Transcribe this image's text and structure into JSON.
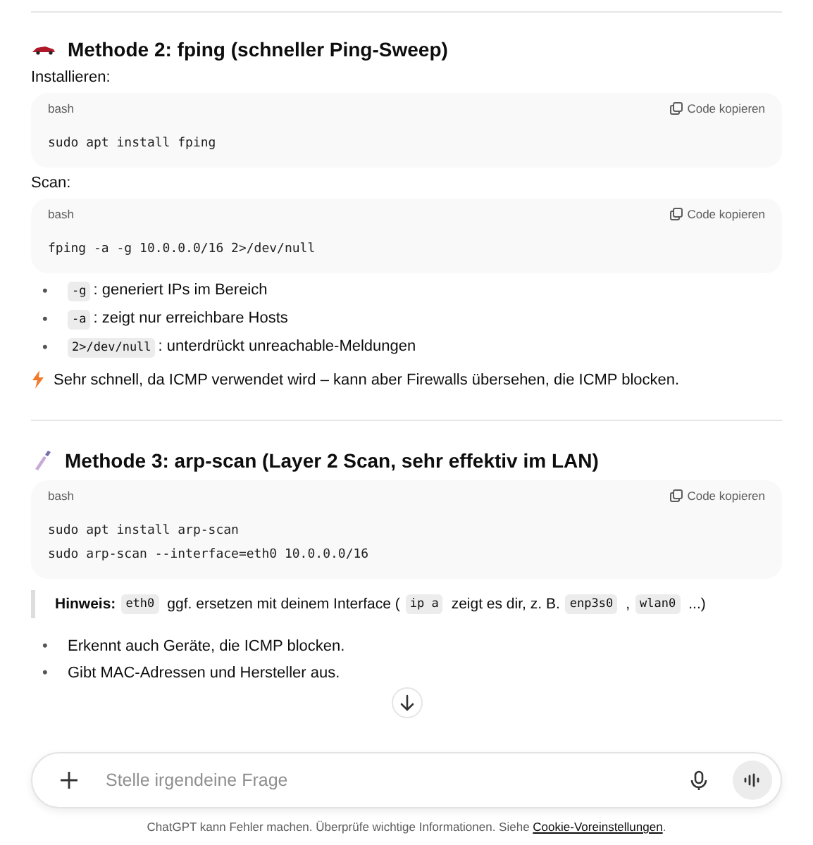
{
  "sections": [
    {
      "title": "Methode 2: fping (schneller Ping-Sweep)",
      "blocks": [
        {
          "kind": "para",
          "text": "Installieren:"
        },
        {
          "kind": "code",
          "language": "bash",
          "copy_label": "Code kopieren",
          "lines": [
            "sudo apt install fping"
          ]
        },
        {
          "kind": "para",
          "text": "Scan:"
        },
        {
          "kind": "code",
          "language": "bash",
          "copy_label": "Code kopieren",
          "lines": [
            "fping -a -g 10.0.0.0/16 2>/dev/null"
          ]
        },
        {
          "kind": "bullets",
          "marker": "•",
          "items": [
            {
              "parts": [
                {
                  "kind": "code",
                  "text": "-g"
                },
                {
                  "kind": "text",
                  "text": ": generiert IPs im Bereich"
                }
              ]
            },
            {
              "parts": [
                {
                  "kind": "code",
                  "text": "-a"
                },
                {
                  "kind": "text",
                  "text": ": zeigt nur erreichbare Hosts"
                }
              ]
            },
            {
              "parts": [
                {
                  "kind": "code",
                  "text": "2>/dev/null"
                },
                {
                  "kind": "text",
                  "text": ": unterdrückt unreachable-Meldungen"
                }
              ]
            }
          ]
        },
        {
          "kind": "note",
          "text": "Sehr schnell, da ICMP verwendet wird – kann aber Firewalls übersehen, die ICMP blocken."
        }
      ]
    },
    {
      "title": "Methode 3: arp-scan (Layer 2 Scan, sehr effektiv im LAN)",
      "blocks": [
        {
          "kind": "code",
          "language": "bash",
          "copy_label": "Code kopieren",
          "lines": [
            "sudo apt install arp-scan",
            "sudo arp-scan --interface=eth0 10.0.0.0/16"
          ]
        },
        {
          "kind": "quote",
          "parts": [
            {
              "kind": "bold",
              "text": "Hinweis:"
            },
            {
              "kind": "code",
              "text": "eth0"
            },
            {
              "kind": "text",
              "text": "ggf. ersetzen mit deinem Interface ("
            },
            {
              "kind": "code",
              "text": "ip a"
            },
            {
              "kind": "text",
              "text": "zeigt es dir, z. B."
            },
            {
              "kind": "code",
              "text": "enp3s0"
            },
            {
              "kind": "text",
              "text": ","
            },
            {
              "kind": "code",
              "text": "wlan0"
            },
            {
              "kind": "text",
              "text": "...)"
            }
          ]
        },
        {
          "kind": "bullets",
          "marker": "•",
          "items": [
            {
              "parts": [
                {
                  "kind": "text",
                  "text": "Erkennt auch Geräte, die ICMP blocken."
                }
              ]
            },
            {
              "parts": [
                {
                  "kind": "text",
                  "text": "Gibt MAC-Adressen und Hersteller aus."
                }
              ]
            }
          ]
        }
      ]
    }
  ],
  "composer": {
    "placeholder": "Stelle irgendeine Frage"
  },
  "footer": {
    "text": "ChatGPT kann Fehler machen. Überprüfe wichtige Informationen. Siehe",
    "link": "Cookie-Voreinstellungen",
    "after": "."
  }
}
